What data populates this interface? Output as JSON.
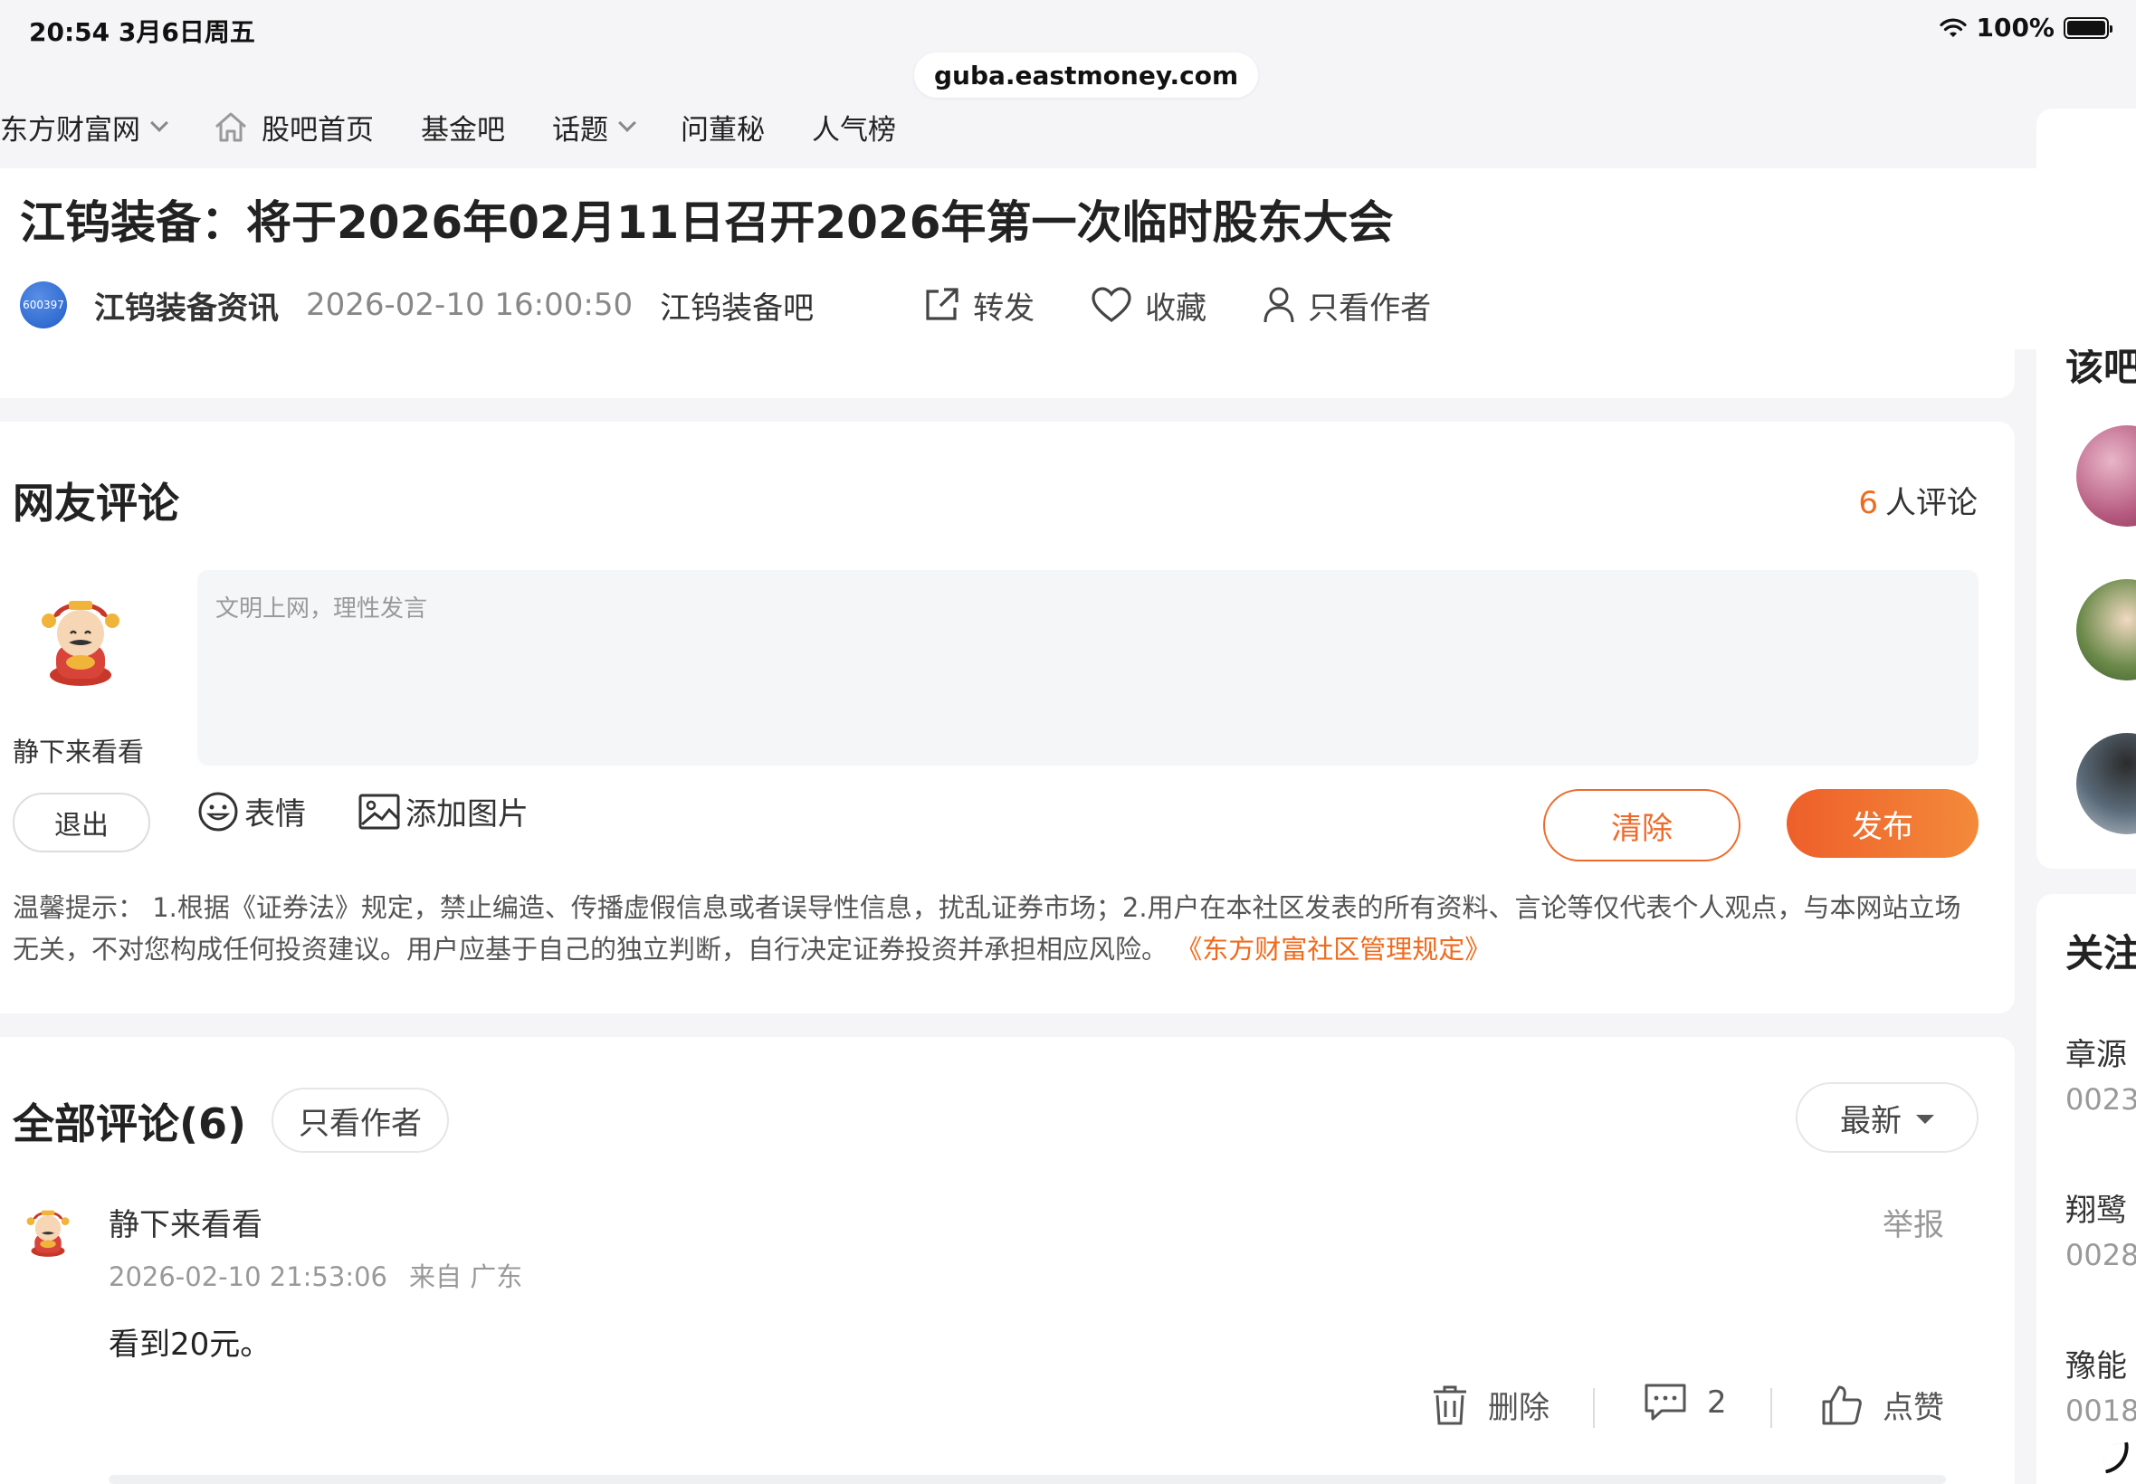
{
  "status_bar": {
    "time": "20:54   3月6日周五",
    "battery": "100%"
  },
  "browser": {
    "url": "guba.eastmoney.com"
  },
  "nav": {
    "items": [
      {
        "label": "东方财富网"
      },
      {
        "label": "股吧首页"
      },
      {
        "label": "基金吧"
      },
      {
        "label": "话题"
      },
      {
        "label": "问董秘"
      },
      {
        "label": "人气榜"
      }
    ]
  },
  "post": {
    "title": "江钨装备：将于2026年02月11日召开2026年第一次临时股东大会",
    "avatar_text": "600397",
    "author": "江钨装备资讯",
    "date": "2026-02-10 16:00:50",
    "bar": "江钨装备吧",
    "actions": {
      "share": "转发",
      "favorite": "收藏",
      "author_only": "只看作者"
    }
  },
  "comment_box": {
    "heading": "网友评论",
    "count": "6",
    "count_suffix": "人评论",
    "username": "静下来看看",
    "placeholder": "文明上网，理性发言",
    "logout": "退出",
    "emoji": "表情",
    "add_image": "添加图片",
    "clear": "清除",
    "publish": "发布",
    "notice": "温馨提示： 1.根据《证券法》规定，禁止编造、传播虚假信息或者误导性信息，扰乱证券市场；2.用户在本社区发表的所有资料、言论等仅代表个人观点，与本网站立场无关，不对您构成任何投资建议。用户应基于自己的独立判断，自行决定证券投资并承担相应风险。",
    "notice_link": "《东方财富社区管理规定》"
  },
  "comments": {
    "heading": "全部评论(6)",
    "author_only": "只看作者",
    "sort": "最新",
    "items": [
      {
        "user": "静下来看看",
        "time": "2026-02-10 21:53:06",
        "location": "来自 广东",
        "text": "看到20元。",
        "report": "举报",
        "delete": "删除",
        "reply_count": "2",
        "like": "点赞"
      }
    ]
  },
  "sidebar": {
    "section1_title": "该吧",
    "section2_title": "关注",
    "stocks": [
      {
        "name": "章源",
        "code": "0023"
      },
      {
        "name": "翔鹭",
        "code": "0028"
      },
      {
        "name": "豫能",
        "code": "0018"
      }
    ]
  },
  "colors": {
    "accent": "#f06a1c",
    "publish_start": "#ee5f2a",
    "publish_end": "#f38a3a"
  }
}
